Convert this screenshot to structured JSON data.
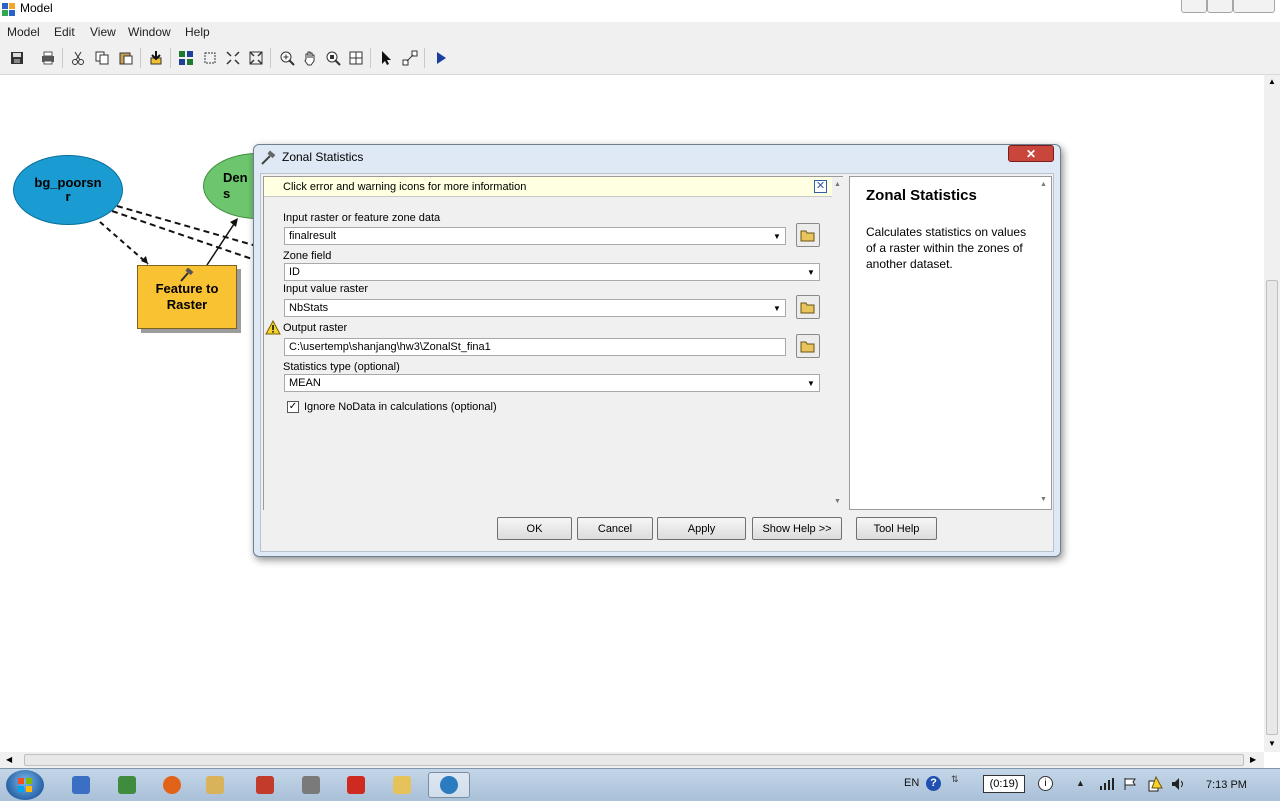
{
  "window": {
    "title": "Model"
  },
  "menu": {
    "items": [
      "Model",
      "Edit",
      "View",
      "Window",
      "Help"
    ]
  },
  "toolbar": {
    "buttons": [
      "save-icon",
      "print-icon",
      "cut-icon",
      "copy-icon",
      "paste-icon",
      "add-data-icon",
      "auto-layout-icon",
      "full-extent-icon",
      "zoom-in-icon",
      "zoom-out-icon",
      "zoom-icon",
      "pan-icon",
      "zoom-layout-icon",
      "select-icon",
      "connect-icon",
      "run-icon"
    ]
  },
  "model": {
    "node_bg": "bg_poorsn\nr",
    "node_den": "Den\ns",
    "node_ftr": "Feature to\nRaster"
  },
  "dialog": {
    "title": "Zonal Statistics",
    "info_bar": "Click error and warning icons for more information",
    "params": {
      "input_zone_label": "Input raster or feature zone data",
      "input_zone_value": "finalresult",
      "zone_field_label": "Zone field",
      "zone_field_value": "ID",
      "input_value_label": "Input value raster",
      "input_value_value": "NbStats",
      "output_label": "Output raster",
      "output_value": "C:\\usertemp\\shanjang\\hw3\\ZonalSt_fina1",
      "stats_label": "Statistics type (optional)",
      "stats_value": "MEAN",
      "ignore_nodata_label": "Ignore NoData in calculations (optional)",
      "ignore_nodata_checked": true
    },
    "help": {
      "title": "Zonal Statistics",
      "description": "Calculates statistics on values of a raster within the zones of another dataset."
    },
    "buttons": {
      "ok": "OK",
      "cancel": "Cancel",
      "apply": "Apply",
      "show_help": "Show Help >>",
      "tool_help": "Tool Help"
    }
  },
  "taskbar": {
    "lang": "EN",
    "timer": "(0:19)",
    "clock": "7:13 PM"
  },
  "colors": {
    "node_blue": "#1a9bd1",
    "node_green": "#6dc66d",
    "node_tool": "#f9c233",
    "info_bar": "#ffffe1",
    "close_red": "#c9463d"
  }
}
